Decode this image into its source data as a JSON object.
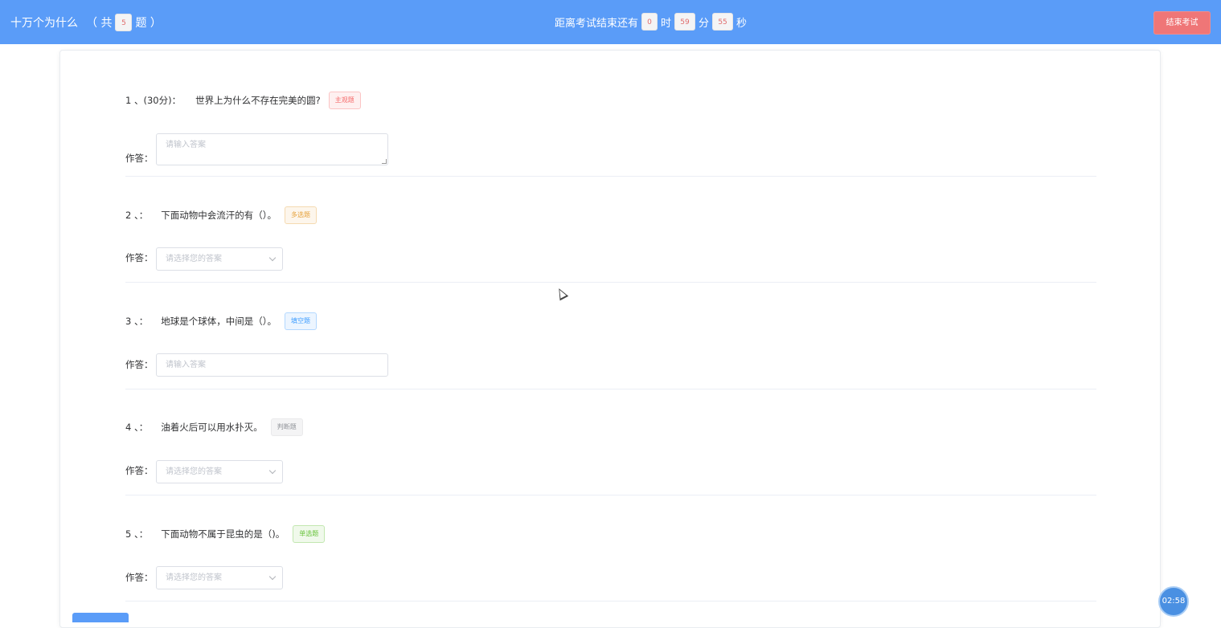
{
  "header": {
    "title": "十万个为什么",
    "count_prefix": "（ 共",
    "count": "5",
    "count_suffix": "题 ）",
    "countdown_prefix": "距离考试结束还有",
    "hours": "0",
    "hours_unit": "时",
    "minutes": "59",
    "minutes_unit": "分",
    "seconds": "55",
    "seconds_unit": "秒",
    "end_button": "结束考试"
  },
  "answer_label": "作答：",
  "questions": [
    {
      "num": "1 、(30分)：",
      "text": "世界上为什么不存在完美的圆?",
      "tag": "主观题",
      "answer_placeholder": "请输入答案"
    },
    {
      "num": "2 、：",
      "text": "下面动物中会流汗的有（）。",
      "tag": "多选题",
      "answer_placeholder": "请选择您的答案"
    },
    {
      "num": "3 、：",
      "text": "地球是个球体，中间是（）。",
      "tag": "填空题",
      "answer_placeholder": "请输入答案"
    },
    {
      "num": "4 、：",
      "text": "油着火后可以用水扑灭。",
      "tag": "判断题",
      "answer_placeholder": "请选择您的答案"
    },
    {
      "num": "5 、：",
      "text": "下面动物不属于昆虫的是（)。",
      "tag": "单选题",
      "answer_placeholder": "请选择您的答案"
    }
  ],
  "float_timer": "02:58",
  "colors": {
    "header_bg": "#5a9cf8",
    "end_button_bg": "#ef7677",
    "tag_subjective": "#f56c6c",
    "tag_multi": "#e6a23c",
    "tag_fill": "#409eff",
    "tag_judge": "#909399",
    "tag_single": "#67c23a"
  }
}
